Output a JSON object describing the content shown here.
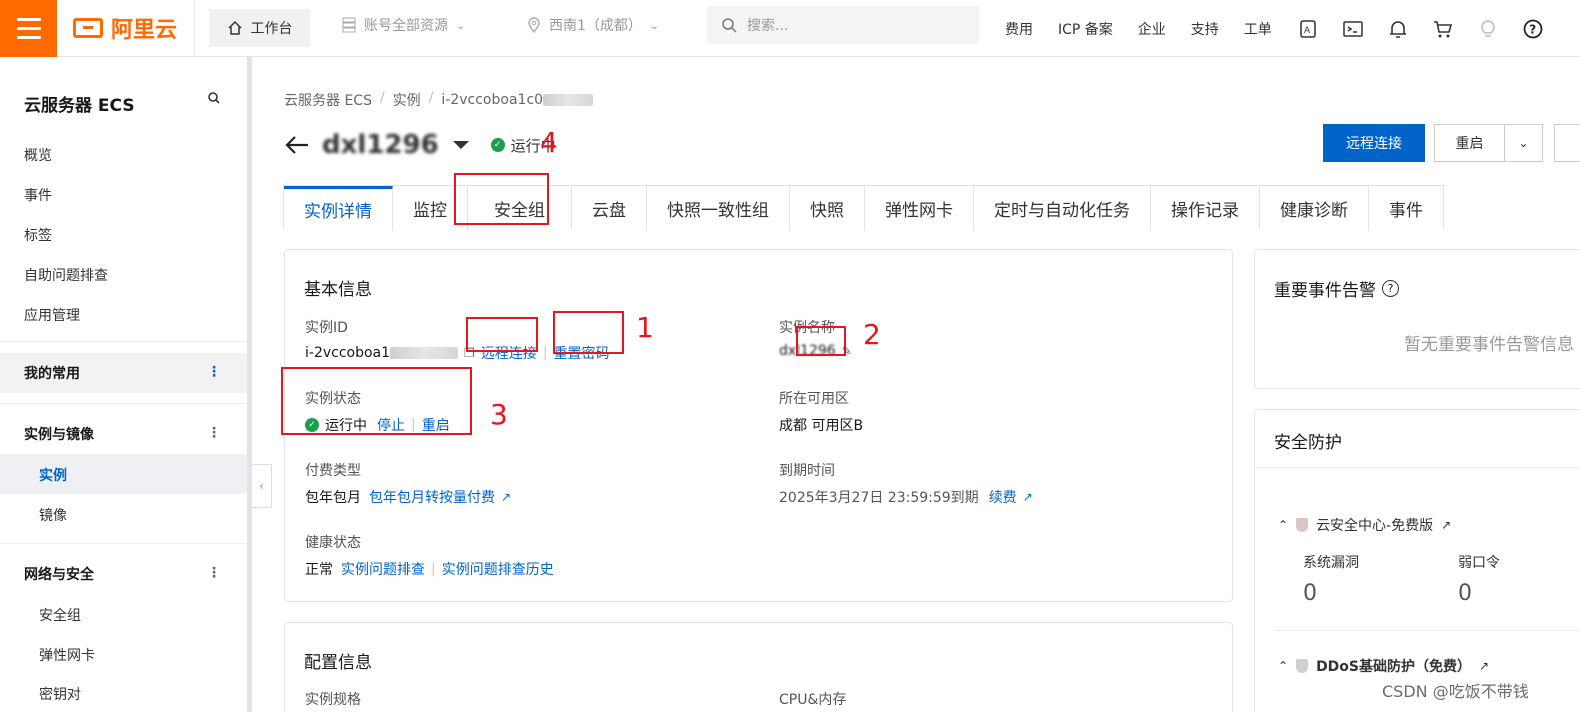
{
  "topnav": {
    "logo_text": "阿里云",
    "workbench": "工作台",
    "account_resources": "账号全部资源",
    "region": "西南1（成都）",
    "search_placeholder": "搜索...",
    "links": [
      "费用",
      "ICP 备案",
      "企业",
      "支持",
      "工单"
    ],
    "icons": [
      "api-icon",
      "terminal-icon",
      "bell-icon",
      "cart-icon",
      "lightbulb-icon",
      "help-icon"
    ]
  },
  "sidebar": {
    "title": "云服务器 ECS",
    "top_items": [
      "概览",
      "事件",
      "标签",
      "自助问题排查",
      "应用管理"
    ],
    "group_favorites": "我的常用",
    "group_instances": "实例与镜像",
    "instance_items": [
      "实例",
      "镜像"
    ],
    "group_network": "网络与安全",
    "network_items": [
      "安全组",
      "弹性网卡",
      "密钥对"
    ]
  },
  "breadcrumb": [
    "云服务器 ECS",
    "实例",
    "i-2vccoboa1c0"
  ],
  "header": {
    "instance_name": "dxl1296",
    "status": "运行中",
    "remote_connect": "远程连接",
    "reboot": "重启"
  },
  "tabs": [
    "实例详情",
    "监控",
    "安全组",
    "云盘",
    "快照一致性组",
    "快照",
    "弹性网卡",
    "定时与自动化任务",
    "操作记录",
    "健康诊断",
    "事件"
  ],
  "basic_info": {
    "title": "基本信息",
    "instance_id_label": "实例ID",
    "instance_id_value": "i-2vccoboa1",
    "remote_connect_link": "远程连接",
    "reset_password_link": "重置密码",
    "instance_name_label": "实例名称",
    "instance_name_value": "dxl1296",
    "status_label": "实例状态",
    "status_value": "运行中",
    "stop_link": "停止",
    "reboot_link": "重启",
    "zone_label": "所在可用区",
    "zone_value": "成都 可用区B",
    "billing_label": "付费类型",
    "billing_value": "包年包月",
    "billing_convert_link": "包年包月转按量付费",
    "expire_label": "到期时间",
    "expire_value": "2025年3月27日 23:59:59到期",
    "renew_link": "续费",
    "health_label": "健康状态",
    "health_value": "正常",
    "troubleshoot_link": "实例问题排查",
    "troubleshoot_history_link": "实例问题排查历史"
  },
  "config_info": {
    "title": "配置信息",
    "spec_label": "实例规格",
    "cpu_label": "CPU&内存"
  },
  "alerts_panel": {
    "title": "重要事件告警",
    "empty": "暂无重要事件告警信息"
  },
  "security_panel": {
    "title": "安全防护",
    "security_center": "云安全中心-免费版",
    "vuln_label": "系统漏洞",
    "vuln_value": "0",
    "weak_pwd_label": "弱口令",
    "weak_pwd_value": "0",
    "ddos": "DDoS基础防护（免费）"
  },
  "annotations": [
    "1",
    "2",
    "3",
    "4"
  ],
  "watermark": "CSDN @吃饭不带钱",
  "colors": {
    "accent": "#0064c8",
    "brand": "#ff6a00",
    "annotation": "#e5161f",
    "success": "#1a9f4b"
  }
}
